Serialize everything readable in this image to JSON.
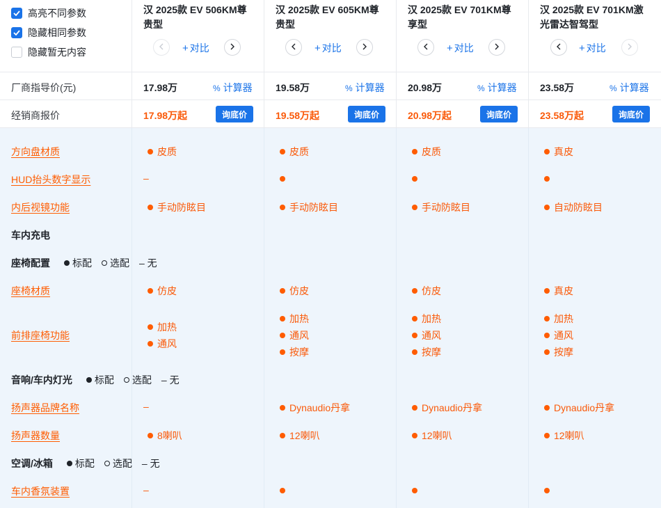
{
  "options": [
    {
      "label": "高亮不同参数",
      "checked": true
    },
    {
      "label": "隐藏相同参数",
      "checked": true
    },
    {
      "label": "隐藏暂无内容",
      "checked": false
    }
  ],
  "compare_label": "对比",
  "models": [
    {
      "name": "汉 2025款 EV 506KM尊贵型",
      "msrp": "17.98万",
      "dealer_price": "17.98万起"
    },
    {
      "name": "汉 2025款 EV 605KM尊贵型",
      "msrp": "19.58万",
      "dealer_price": "19.58万起"
    },
    {
      "name": "汉 2025款 EV 701KM尊享型",
      "msrp": "20.98万",
      "dealer_price": "20.98万起"
    },
    {
      "name": "汉 2025款 EV 701KM激光雷达智驾型",
      "msrp": "23.58万",
      "dealer_price": "23.58万起"
    }
  ],
  "price_rows": {
    "msrp_label": "厂商指导价(元)",
    "dealer_label": "经销商报价",
    "calculator_label": "计算器",
    "ask_price_label": "询底价"
  },
  "legend": {
    "standard": "标配",
    "optional": "选配",
    "none": "– 无"
  },
  "rows": [
    {
      "label": "方向盘材质",
      "values": [
        "皮质",
        "皮质",
        "皮质",
        "真皮"
      ]
    },
    {
      "label": "HUD抬头数字显示",
      "values": [
        "–",
        "●",
        "●",
        "●"
      ]
    },
    {
      "label": "内后视镜功能",
      "values": [
        "手动防眩目",
        "手动防眩目",
        "手动防眩目",
        "自动防眩目"
      ]
    }
  ],
  "sections": {
    "charging": "车内充电",
    "seat": "座椅配置",
    "audio": "音响/车内灯光",
    "ac": "空调/冰箱"
  },
  "seat_rows": [
    {
      "label": "座椅材质",
      "values": [
        "仿皮",
        "仿皮",
        "仿皮",
        "真皮"
      ]
    },
    {
      "label": "前排座椅功能",
      "values": [
        [
          "加热",
          "通风"
        ],
        [
          "加热",
          "通风",
          "按摩"
        ],
        [
          "加热",
          "通风",
          "按摩"
        ],
        [
          "加热",
          "通风",
          "按摩"
        ]
      ]
    }
  ],
  "audio_rows": [
    {
      "label": "扬声器品牌名称",
      "values": [
        "–",
        "Dynaudio丹拿",
        "Dynaudio丹拿",
        "Dynaudio丹拿"
      ]
    },
    {
      "label": "扬声器数量",
      "values": [
        "8喇叭",
        "12喇叭",
        "12喇叭",
        "12喇叭"
      ]
    }
  ],
  "ac_rows": [
    {
      "label": "车内香氛装置",
      "values": [
        "–",
        "●",
        "●",
        "●"
      ]
    }
  ],
  "colors": {
    "accent": "#1a73e8",
    "highlight": "#ff5c00",
    "body_bg": "#eef5fc"
  }
}
